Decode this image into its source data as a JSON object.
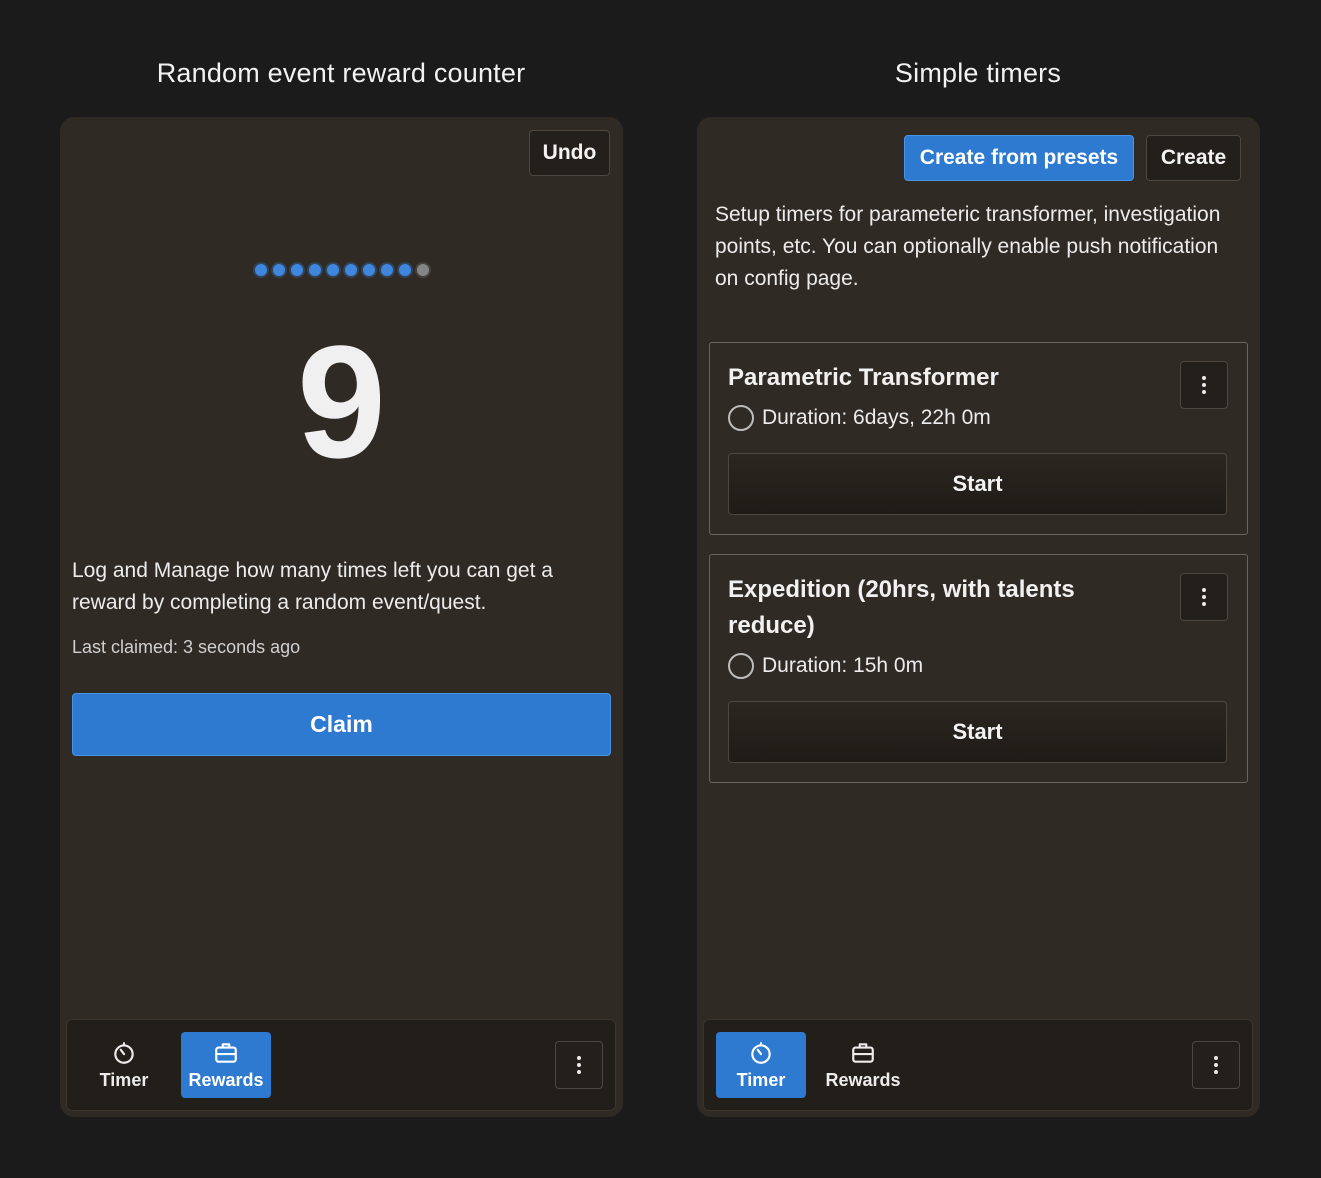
{
  "left_panel": {
    "title": "Random event reward counter",
    "undo_label": "Undo",
    "dots": {
      "filled": 9,
      "total": 10
    },
    "count": "9",
    "description": "Log and Manage how many times left you can get a reward by completing a random event/quest.",
    "last_claimed": "Last claimed: 3 seconds ago",
    "claim_label": "Claim"
  },
  "right_panel": {
    "title": "Simple timers",
    "create_from_presets_label": "Create from presets",
    "create_label": "Create",
    "description": "Setup timers for parameteric transformer, investigation points, etc. You can optionally enable push notification on config page.",
    "timers": [
      {
        "name": "Parametric Transformer",
        "duration": "Duration: 6days, 22h 0m",
        "start_label": "Start"
      },
      {
        "name": "Expedition (20hrs, with talents reduce)",
        "duration": "Duration: 15h 0m",
        "start_label": "Start"
      }
    ]
  },
  "nav": {
    "timer_label": "Timer",
    "rewards_label": "Rewards",
    "left_active": "rewards",
    "right_active": "timer"
  },
  "colors": {
    "accent": "#2f7ad1",
    "background": "#1b1b1b",
    "panel": "#2f2a24"
  },
  "icons": [
    "timer-icon",
    "briefcase-icon",
    "kebab-menu-icon"
  ]
}
